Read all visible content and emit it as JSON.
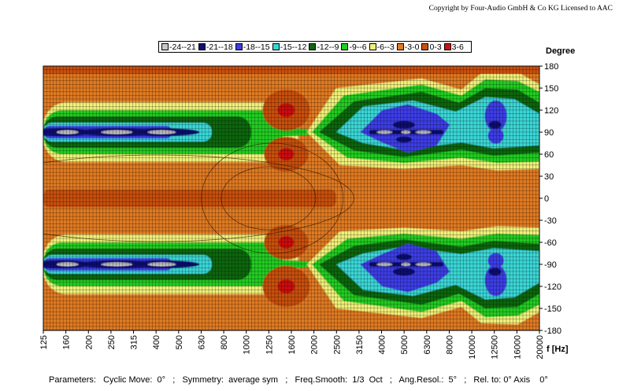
{
  "copyright": "Copyright by Four-Audio GmbH & Co KG   Licensed to AAC",
  "parameters": "Parameters:   Cyclic Move:  0°   ;   Symmetry:  average sym   ;   Freq.Smooth:  1/3  Oct   ;   Ang.Resol.:  5°   ;   Rel. to: 0° Axis    0°",
  "colors": {
    "-24--21": "#c8c8c8",
    "-21--18": "#101070",
    "-18--15": "#3c3ce6",
    "-15--12": "#3ad6d6",
    "-12--9": "#116611",
    "-9--6": "#22cc22",
    "-6--3": "#f0f07a",
    "-3-0": "#e07a22",
    "0-3": "#c85010",
    "3-6": "#cc1111"
  },
  "chart_data": {
    "type": "heatmap",
    "title": "",
    "xlabel": "f [Hz]",
    "ylabel": "Degree",
    "x_scale": "log",
    "xlim": [
      125,
      20000
    ],
    "ylim": [
      -180,
      180
    ],
    "x_ticks": [
      "125",
      "160",
      "200",
      "250",
      "315",
      "400",
      "500",
      "630",
      "800",
      "1000",
      "1250",
      "1600",
      "2000",
      "2500",
      "3150",
      "4000",
      "5000",
      "6300",
      "8000",
      "10000",
      "12500",
      "16000",
      "20000"
    ],
    "y_ticks": [
      "180",
      "150",
      "120",
      "90",
      "60",
      "30",
      "0",
      "-30",
      "-60",
      "-90",
      "-120",
      "-150",
      "-180"
    ],
    "legend": [
      "-24--21",
      "-21--18",
      "-18--15",
      "-15--12",
      "-12--9",
      "-9--6",
      "-6--3",
      "-3-0",
      "0-3",
      "3-6"
    ],
    "features": [
      {
        "f": 1500,
        "angle": 120,
        "level": "3-6"
      },
      {
        "f": 1500,
        "angle": 60,
        "level": "3-6"
      },
      {
        "f": 1500,
        "angle": -60,
        "level": "3-6"
      },
      {
        "f": 1500,
        "angle": -120,
        "level": "3-6"
      },
      {
        "f": 160,
        "angle": 90,
        "level": "-24--21"
      },
      {
        "f": 250,
        "angle": 90,
        "level": "-24--21"
      },
      {
        "f": 400,
        "angle": 90,
        "level": "-24--21"
      },
      {
        "f": 160,
        "angle": -90,
        "level": "-24--21"
      },
      {
        "f": 250,
        "angle": -90,
        "level": "-24--21"
      },
      {
        "f": 400,
        "angle": -90,
        "level": "-24--21"
      },
      {
        "f": 4000,
        "angle": 90,
        "level": "-24--21"
      },
      {
        "f": 6300,
        "angle": 90,
        "level": "-24--21"
      },
      {
        "f": 4000,
        "angle": -90,
        "level": "-24--21"
      },
      {
        "f": 6300,
        "angle": -90,
        "level": "-24--21"
      }
    ]
  }
}
